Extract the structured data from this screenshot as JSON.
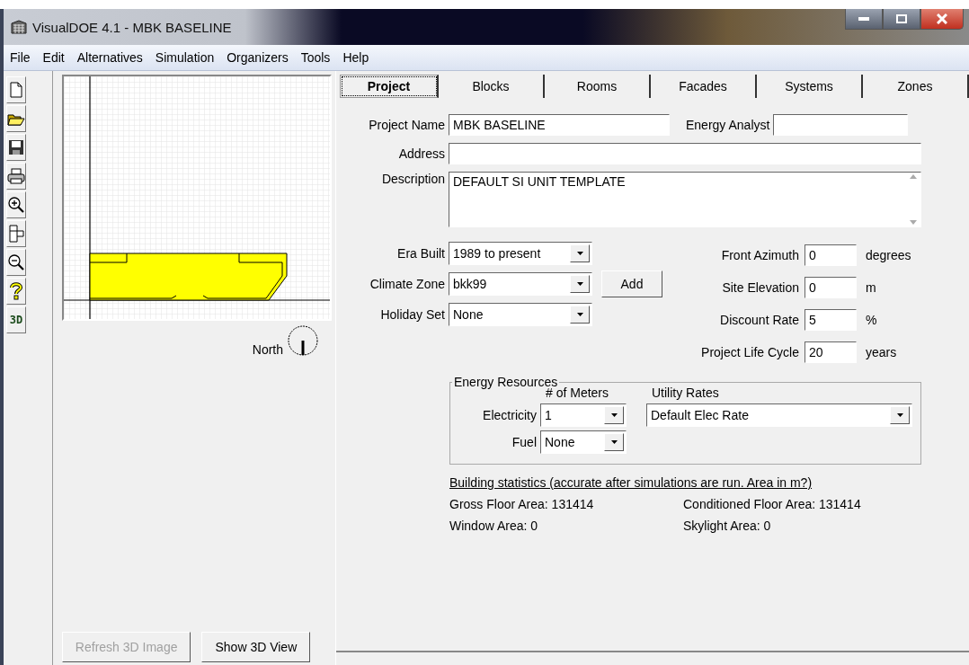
{
  "window": {
    "title": "VisualDOE 4.1 - MBK BASELINE"
  },
  "menu": [
    "File",
    "Edit",
    "Alternatives",
    "Simulation",
    "Organizers",
    "Tools",
    "Help"
  ],
  "toolbar": [
    {
      "kind": "new"
    },
    {
      "kind": "open"
    },
    {
      "kind": "save"
    },
    {
      "kind": "print"
    },
    {
      "kind": "zoom-in"
    },
    {
      "kind": "blocks"
    },
    {
      "kind": "zoom-out"
    },
    {
      "kind": "help"
    },
    {
      "kind": "text",
      "label": "3D"
    }
  ],
  "plan": {
    "north_label": "North"
  },
  "view_buttons": [
    {
      "label": "Refresh 3D Image",
      "disabled": true
    },
    {
      "label": "Show 3D View",
      "disabled": false
    }
  ],
  "tabs": [
    {
      "label": "Project",
      "selected": true
    },
    {
      "label": "Blocks",
      "selected": false
    },
    {
      "label": "Rooms",
      "selected": false
    },
    {
      "label": "Facades",
      "selected": false
    },
    {
      "label": "Systems",
      "selected": false
    },
    {
      "label": "Zones",
      "selected": false
    }
  ],
  "project": {
    "name_label": "Project Name",
    "name_value": "MBK BASELINE",
    "analyst_label": "Energy Analyst",
    "address_label": "Address",
    "description_label": "Description",
    "description_value": "DEFAULT SI UNIT TEMPLATE"
  },
  "dropdowns": [
    {
      "label": "Era Built",
      "value": "1989 to present"
    },
    {
      "label": "Climate Zone",
      "value": "bkk99",
      "button": "Add"
    },
    {
      "label": "Holiday Set",
      "value": "None"
    }
  ],
  "numbers": [
    {
      "label": "Front Azimuth",
      "value": "0",
      "unit": "degrees"
    },
    {
      "label": "Site Elevation",
      "value": "0",
      "unit": "m"
    },
    {
      "label": "Discount Rate",
      "value": "5",
      "unit": "%"
    },
    {
      "label": "Project Life Cycle",
      "value": "20",
      "unit": "years"
    }
  ],
  "energy_resources": {
    "title": "Energy Resources",
    "meters_header": "# of Meters",
    "rates_header": "Utility Rates",
    "rows": [
      {
        "label": "Electricity",
        "meters": "1",
        "rate": "Default Elec Rate"
      },
      {
        "label": "Fuel",
        "meters": "None"
      }
    ]
  },
  "statistics": {
    "heading": "Building statistics (accurate after simulations are run. Area in m?)",
    "items": [
      "Gross Floor Area: 131414",
      "Conditioned Floor Area: 131414",
      "Window Area: 0",
      "Skylight Area: 0"
    ]
  }
}
